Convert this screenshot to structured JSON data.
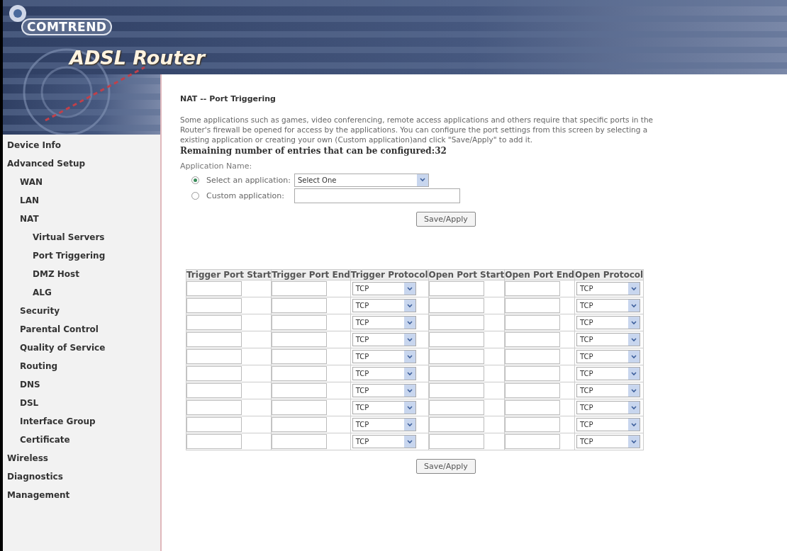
{
  "header": {
    "brand": "COMTREND",
    "product": "ADSL Router"
  },
  "sidebar": {
    "items": [
      {
        "label": "Device Info"
      },
      {
        "label": "Advanced Setup",
        "children": [
          {
            "label": "WAN"
          },
          {
            "label": "LAN"
          },
          {
            "label": "NAT",
            "children": [
              {
                "label": "Virtual Servers"
              },
              {
                "label": "Port Triggering"
              },
              {
                "label": "DMZ Host"
              },
              {
                "label": "ALG"
              }
            ]
          },
          {
            "label": "Security"
          },
          {
            "label": "Parental Control"
          },
          {
            "label": "Quality of Service"
          },
          {
            "label": "Routing"
          },
          {
            "label": "DNS"
          },
          {
            "label": "DSL"
          },
          {
            "label": "Interface Group"
          },
          {
            "label": "Certificate"
          }
        ]
      },
      {
        "label": "Wireless"
      },
      {
        "label": "Diagnostics"
      },
      {
        "label": "Management"
      }
    ]
  },
  "page": {
    "title": "NAT -- Port Triggering",
    "description_lines": [
      "Some applications such as games, video conferencing, remote access applications and others require that specific ports in the",
      "Router's firewall be opened for access by the applications. You can configure the port settings from this screen by selecting a",
      "existing application or creating your own (Custom application)and click \"Save/Apply\" to add it."
    ],
    "remaining": "Remaining number of entries that can be configured:32",
    "app_name_label": "Application Name:",
    "options": [
      {
        "label": "Select an application:",
        "selected": true,
        "kind": "select",
        "value": "Select One"
      },
      {
        "label": "Custom application:",
        "selected": false,
        "kind": "text"
      }
    ],
    "save_button_top": "Save/Apply",
    "table": {
      "columns": [
        "Trigger Port Start",
        "Trigger Port End",
        "Trigger Protocol",
        "Open Port Start",
        "Open Port End",
        "Open Protocol"
      ],
      "rows": [
        {
          "trigger_protocol": "TCP",
          "open_protocol": "TCP"
        },
        {
          "trigger_protocol": "TCP",
          "open_protocol": "TCP"
        },
        {
          "trigger_protocol": "TCP",
          "open_protocol": "TCP"
        },
        {
          "trigger_protocol": "TCP",
          "open_protocol": "TCP"
        },
        {
          "trigger_protocol": "TCP",
          "open_protocol": "TCP"
        },
        {
          "trigger_protocol": "TCP",
          "open_protocol": "TCP"
        },
        {
          "trigger_protocol": "TCP",
          "open_protocol": "TCP"
        },
        {
          "trigger_protocol": "TCP",
          "open_protocol": "TCP"
        },
        {
          "trigger_protocol": "TCP",
          "open_protocol": "TCP"
        },
        {
          "trigger_protocol": "TCP",
          "open_protocol": "TCP"
        }
      ]
    },
    "save_button_bottom": "Save/Apply"
  }
}
